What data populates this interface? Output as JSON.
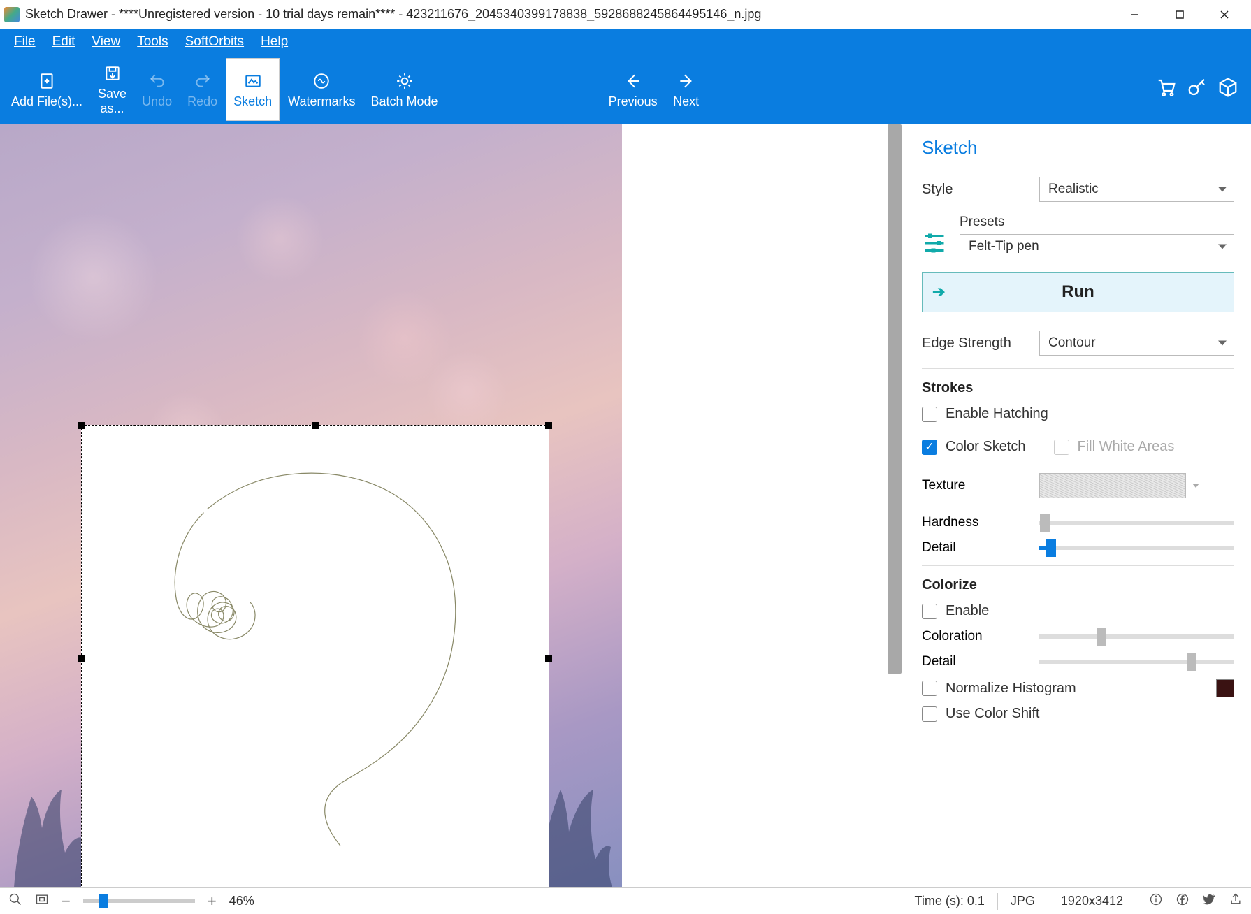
{
  "title": "Sketch Drawer - ****Unregistered version - 10 trial days remain**** - 423211676_2045340399178838_5928688245864495146_n.jpg",
  "menu": {
    "file": "File",
    "edit": "Edit",
    "view": "View",
    "tools": "Tools",
    "softorbits": "SoftOrbits",
    "help": "Help"
  },
  "toolbar": {
    "add": "Add File(s)...",
    "save": "Save as...",
    "undo": "Undo",
    "redo": "Redo",
    "sketch": "Sketch",
    "watermarks": "Watermarks",
    "batch": "Batch Mode",
    "previous": "Previous",
    "next": "Next"
  },
  "panel": {
    "heading": "Sketch",
    "style_label": "Style",
    "style_value": "Realistic",
    "presets_label": "Presets",
    "presets_value": "Felt-Tip pen",
    "run": "Run",
    "edge_label": "Edge Strength",
    "edge_value": "Contour",
    "strokes": {
      "title": "Strokes",
      "enable_hatching": "Enable Hatching",
      "color_sketch": "Color Sketch",
      "fill_white": "Fill White Areas",
      "texture": "Texture",
      "hardness": "Hardness",
      "detail": "Detail"
    },
    "colorize": {
      "title": "Colorize",
      "enable": "Enable",
      "coloration": "Coloration",
      "detail": "Detail",
      "normalize": "Normalize Histogram",
      "color_shift": "Use Color Shift"
    }
  },
  "status": {
    "zoom": "46%",
    "time": "Time (s): 0.1",
    "format": "JPG",
    "dims": "1920x3412"
  }
}
